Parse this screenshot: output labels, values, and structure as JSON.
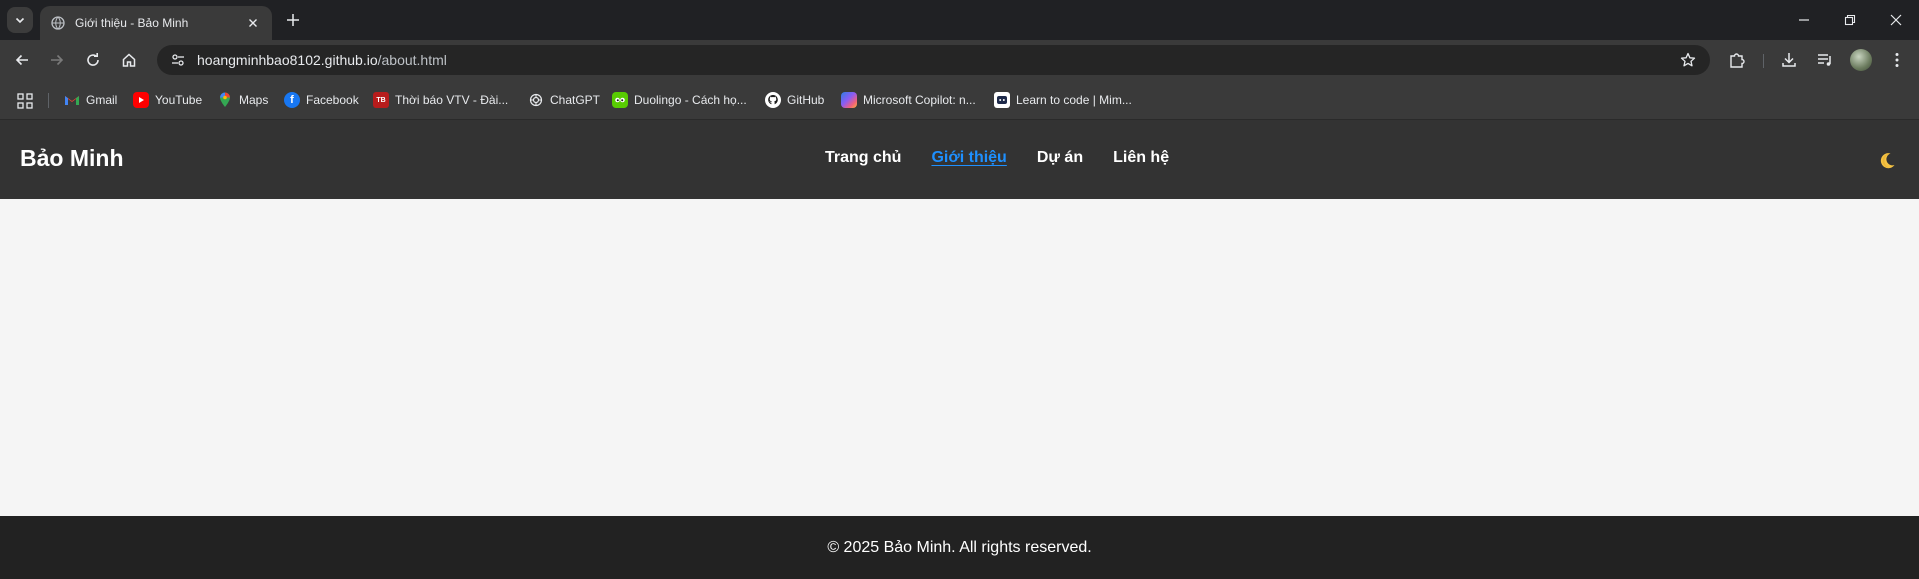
{
  "browser": {
    "tab": {
      "title": "Giới thiệu - Bảo Minh"
    },
    "address": {
      "host": "hoangminhbao8102.github.io",
      "path": "/about.html"
    },
    "bookmarks": [
      {
        "label": "Gmail",
        "icon": "gmail-icon"
      },
      {
        "label": "YouTube",
        "icon": "youtube-icon"
      },
      {
        "label": "Maps",
        "icon": "maps-icon"
      },
      {
        "label": "Facebook",
        "icon": "facebook-icon"
      },
      {
        "label": "Thời báo VTV - Đài...",
        "icon": "vtv-icon"
      },
      {
        "label": "ChatGPT",
        "icon": "chatgpt-icon"
      },
      {
        "label": "Duolingo - Cách họ...",
        "icon": "duolingo-icon"
      },
      {
        "label": "GitHub",
        "icon": "github-icon"
      },
      {
        "label": "Microsoft Copilot: n...",
        "icon": "copilot-icon"
      },
      {
        "label": "Learn to code | Mim...",
        "icon": "mimo-icon"
      }
    ]
  },
  "site": {
    "brand": "Bảo Minh",
    "nav": [
      {
        "label": "Trang chủ",
        "active": false
      },
      {
        "label": "Giới thiệu",
        "active": true
      },
      {
        "label": "Dự án",
        "active": false
      },
      {
        "label": "Liên hệ",
        "active": false
      }
    ],
    "theme_toggle_icon": "moon-icon",
    "accent_color": "#1e90ff",
    "footer": "© 2025 Bảo Minh. All rights reserved."
  }
}
